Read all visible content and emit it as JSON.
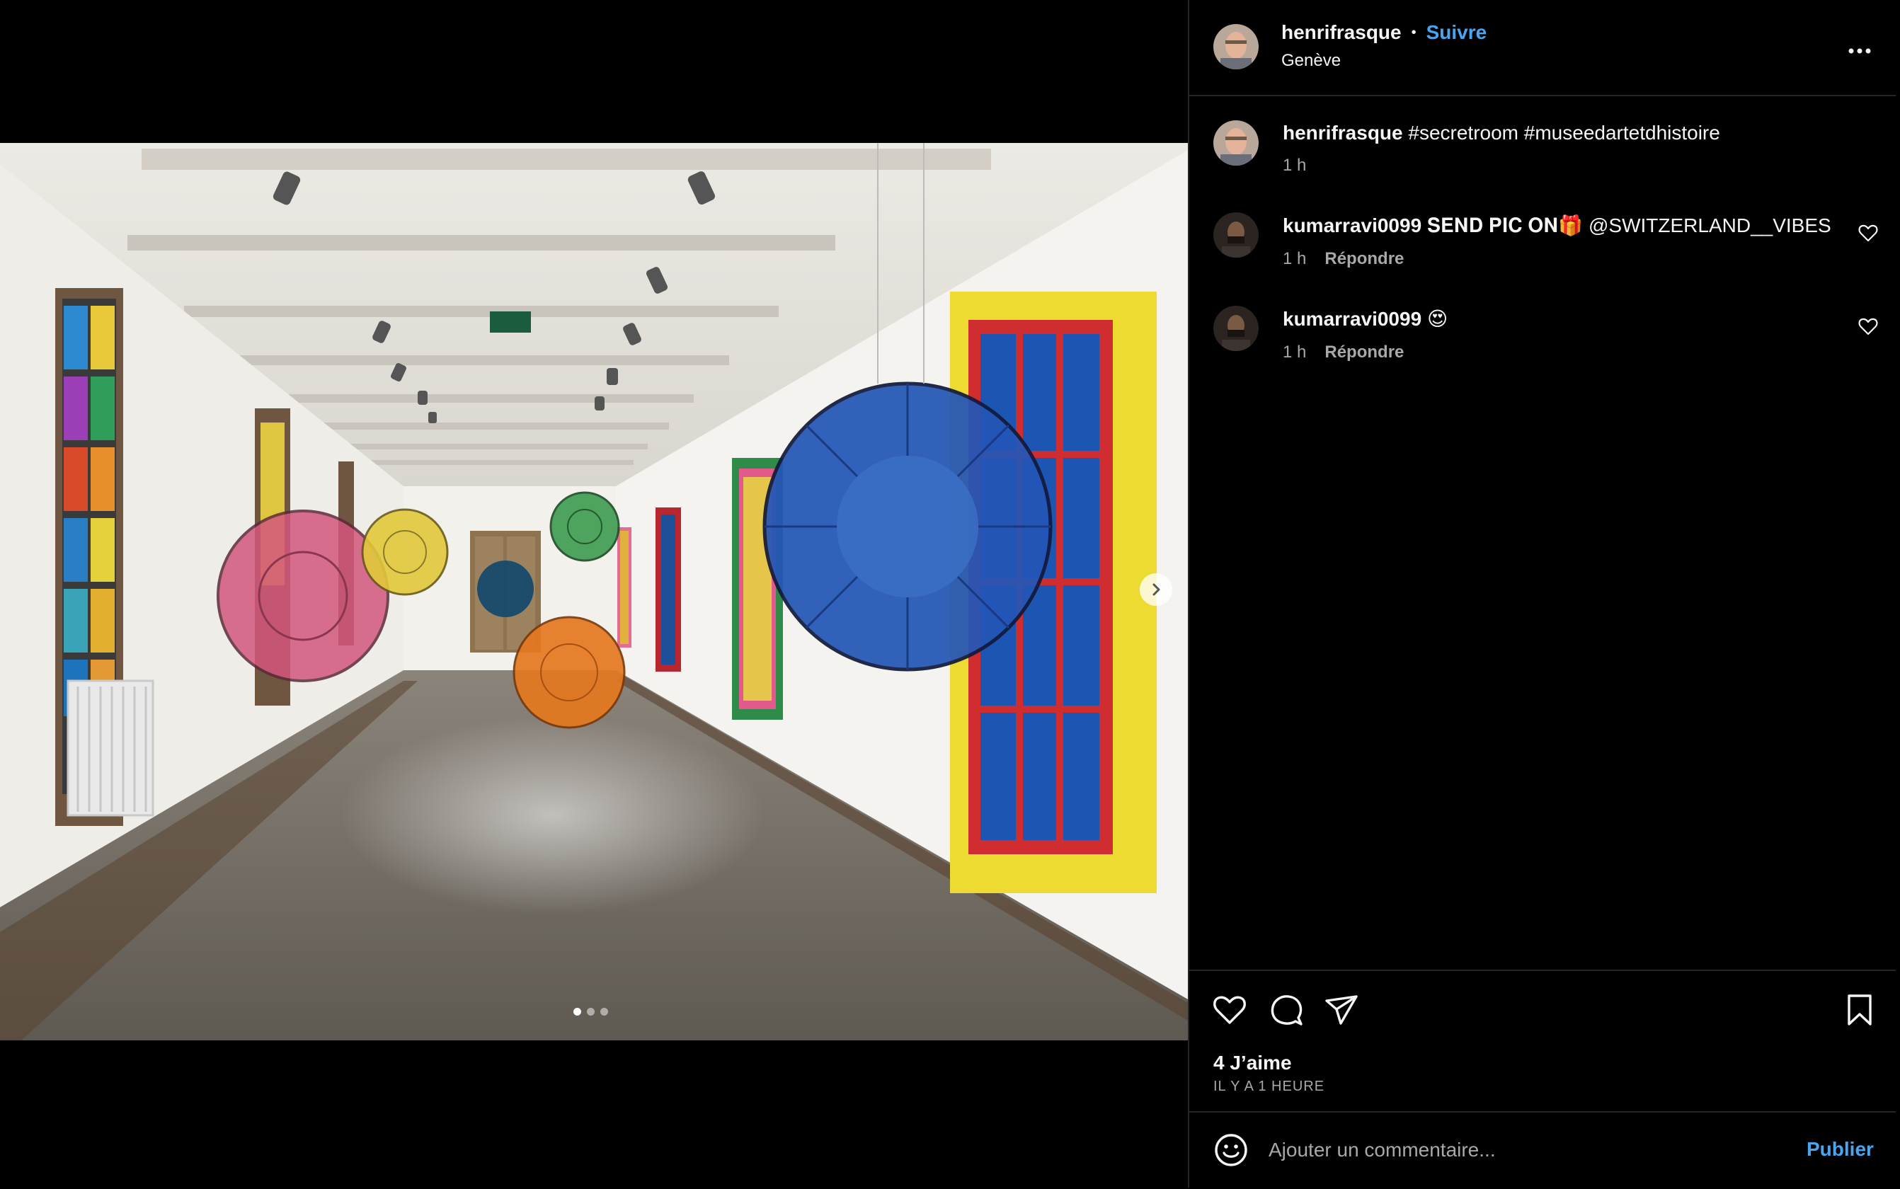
{
  "post": {
    "author": "henrifrasque",
    "separator": "•",
    "follow_label": "Suivre",
    "location": "Genève",
    "more_icon": "more-horizontal-icon"
  },
  "media": {
    "carousel_count": 3,
    "carousel_active_index": 0
  },
  "comments": [
    {
      "user": "henrifrasque",
      "text": "#secretroom #museedartetdhistoire",
      "time": "1 h",
      "reply_label": "",
      "likeable": false
    },
    {
      "user": "kumarravi0099",
      "text": "𝐒𝐄𝐍𝐃 𝐏𝐈𝐂 𝐎𝐍🎁 @SWITZERLAND__VIBES",
      "time": "1 h",
      "reply_label": "Répondre",
      "likeable": true
    },
    {
      "user": "kumarravi0099",
      "text": "😍",
      "time": "1 h",
      "reply_label": "Répondre",
      "likeable": true
    }
  ],
  "actions": {
    "likes": "4 J’aime",
    "posted": "IL Y A 1 HEURE"
  },
  "composer": {
    "placeholder": "Ajouter un commentaire...",
    "publish_label": "Publier"
  },
  "colors": {
    "background": "#000000",
    "accent_blue": "#4aa5f0",
    "secondary_text": "#a8a8a8",
    "divider": "#262626"
  }
}
